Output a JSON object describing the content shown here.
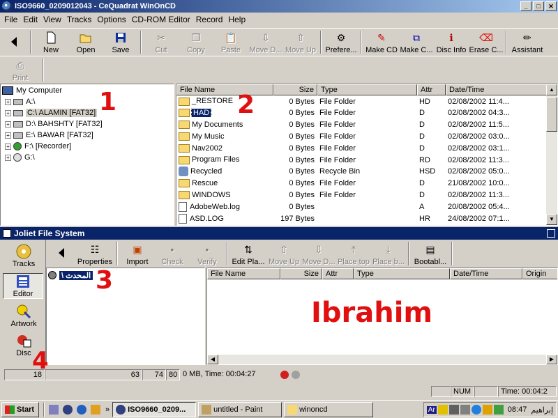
{
  "window": {
    "title": "ISO9660_0209012043 - CeQuadrat WinOnCD",
    "buttons": [
      "_",
      "□",
      "✕"
    ]
  },
  "menu": [
    "File",
    "Edit",
    "View",
    "Tracks",
    "Options",
    "CD-ROM Editor",
    "Record",
    "Help"
  ],
  "toolbar1": [
    {
      "label": "New",
      "icon": "new-icon",
      "disabled": false
    },
    {
      "label": "Open",
      "icon": "open-icon",
      "disabled": false
    },
    {
      "label": "Save",
      "icon": "save-icon",
      "disabled": false
    },
    {
      "label": "Cut",
      "icon": "cut-icon",
      "disabled": true
    },
    {
      "label": "Copy",
      "icon": "copy-icon",
      "disabled": true
    },
    {
      "label": "Paste",
      "icon": "paste-icon",
      "disabled": true
    },
    {
      "label": "Move D...",
      "icon": "move-down-icon",
      "disabled": true
    },
    {
      "label": "Move Up",
      "icon": "move-up-icon",
      "disabled": true
    },
    {
      "label": "Prefere...",
      "icon": "preferences-icon",
      "disabled": false
    },
    {
      "label": "Make CD",
      "icon": "make-cd-icon",
      "disabled": false
    },
    {
      "label": "Make C...",
      "icon": "make-copy-icon",
      "disabled": false
    },
    {
      "label": "Disc Info",
      "icon": "disc-info-icon",
      "disabled": false
    },
    {
      "label": "Erase C...",
      "icon": "erase-icon",
      "disabled": false
    },
    {
      "label": "Assistant",
      "icon": "assistant-icon",
      "disabled": false
    }
  ],
  "print": {
    "label": "Print",
    "icon": "print-icon",
    "disabled": true
  },
  "tree": {
    "root": "My Computer",
    "drives": [
      "A:\\",
      "C:\\ ALAMIN [FAT32]",
      "D:\\ BAHSHTY [FAT32]",
      "E:\\ BAWAR [FAT32]",
      "F:\\ [Recorder]",
      "G:\\"
    ]
  },
  "filelist": {
    "headers": [
      "File Name",
      "Size",
      "Type",
      "Attr",
      "Date/Time"
    ],
    "rows": [
      {
        "name": "_RESTORE",
        "size": "0 Bytes",
        "type": "File Folder",
        "attr": "HD",
        "date": "02/08/2002 11:4...",
        "icon": "folder-icon"
      },
      {
        "name": "HAD",
        "size": "0 Bytes",
        "type": "File Folder",
        "attr": "D",
        "date": "02/08/2002 04:3...",
        "icon": "folder-icon"
      },
      {
        "name": "My Documents",
        "size": "0 Bytes",
        "type": "File Folder",
        "attr": "D",
        "date": "02/08/2002 11:5...",
        "icon": "folder-icon"
      },
      {
        "name": "My Music",
        "size": "0 Bytes",
        "type": "File Folder",
        "attr": "D",
        "date": "02/08/2002 03:0...",
        "icon": "folder-icon"
      },
      {
        "name": "Nav2002",
        "size": "0 Bytes",
        "type": "File Folder",
        "attr": "D",
        "date": "02/08/2002 03:1...",
        "icon": "folder-icon"
      },
      {
        "name": "Program Files",
        "size": "0 Bytes",
        "type": "File Folder",
        "attr": "RD",
        "date": "02/08/2002 11:3...",
        "icon": "folder-icon"
      },
      {
        "name": "Recycled",
        "size": "0 Bytes",
        "type": "Recycle Bin",
        "attr": "HSD",
        "date": "02/08/2002 05:0...",
        "icon": "recycle-icon"
      },
      {
        "name": "Rescue",
        "size": "0 Bytes",
        "type": "File Folder",
        "attr": "D",
        "date": "21/08/2002 10:0...",
        "icon": "folder-icon"
      },
      {
        "name": "WINDOWS",
        "size": "0 Bytes",
        "type": "File Folder",
        "attr": "D",
        "date": "02/08/2002 11:3...",
        "icon": "folder-icon"
      },
      {
        "name": "AdobeWeb.log",
        "size": "0 Bytes",
        "type": "",
        "attr": "A",
        "date": "20/08/2002 05:4...",
        "icon": "file-icon"
      },
      {
        "name": "ASD.LOG",
        "size": "197 Bytes",
        "type": "",
        "attr": "HR",
        "date": "24/08/2002 07:1...",
        "icon": "file-icon"
      }
    ]
  },
  "joliet": {
    "title": "Joliet File System",
    "sidebar": [
      "Tracks",
      "Editor",
      "Artwork",
      "Disc"
    ],
    "toolbar": [
      {
        "label": "Properties",
        "disabled": false
      },
      {
        "label": "Import",
        "disabled": false
      },
      {
        "label": "Check",
        "disabled": true
      },
      {
        "label": "Verify",
        "disabled": true
      },
      {
        "label": "Edit Pla...",
        "disabled": false
      },
      {
        "label": "Move Up",
        "disabled": true
      },
      {
        "label": "Move D...",
        "disabled": true
      },
      {
        "label": "Place top",
        "disabled": true
      },
      {
        "label": "Place b...",
        "disabled": true
      },
      {
        "label": "Bootabl...",
        "disabled": false
      }
    ],
    "tree_root": "\\ المحدث",
    "headers": [
      "File Name",
      "Size",
      "Attr",
      "Type",
      "Date/Time",
      "Origin"
    ]
  },
  "annotations": [
    "1",
    "2",
    "3",
    "4",
    "Ibrahim"
  ],
  "progress": {
    "v1": "18",
    "v2": "63",
    "v3": "74",
    "v4": "80",
    "info": "0 MB, Time: 00:04:27"
  },
  "statusbar": {
    "num": "NUM",
    "time": "Time: 00:04:2"
  },
  "taskbar": {
    "start": "Start",
    "tasks": [
      {
        "label": "ISO9660_0209...",
        "active": true
      },
      {
        "label": "untitled - Paint",
        "active": false
      },
      {
        "label": "winoncd",
        "active": false
      }
    ],
    "tray_lang": "Ar",
    "clock": "08:47",
    "user": "إبراهيم"
  },
  "colors": {
    "annotation": "#e01010",
    "title_bar": "#0a246a",
    "folder": "#f8d870"
  }
}
